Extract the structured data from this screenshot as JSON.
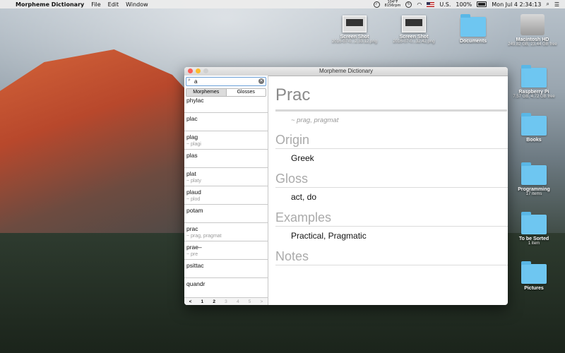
{
  "menubar": {
    "app_name": "Morpheme Dictionary",
    "menus": [
      "File",
      "Edit",
      "Window"
    ],
    "temperature": "104°F",
    "fan": "8156rpm",
    "input_source": "U.S.",
    "battery": "100%",
    "clock": "Mon Jul 4  2:34:13"
  },
  "desktop_icons": [
    {
      "name": "Screen Shot",
      "sub": "2016-07-0...2.33.12.png",
      "kind": "screenshot"
    },
    {
      "name": "Screen Shot",
      "sub": "2016-07-0...32.42.png",
      "kind": "screenshot"
    },
    {
      "name": "Documents",
      "sub": "",
      "kind": "folder"
    },
    {
      "name": "Macintosh HD",
      "sub": "249.82 GB, 23.44 GB free",
      "kind": "drive"
    },
    {
      "name": "Raspberry Pi",
      "sub": "7.57 GB, 4.72 GB free",
      "kind": "folder"
    },
    {
      "name": "Books",
      "sub": "",
      "kind": "folder"
    },
    {
      "name": "Programming",
      "sub": "17 items",
      "kind": "folder"
    },
    {
      "name": "To be Sorted",
      "sub": "1 item",
      "kind": "folder"
    },
    {
      "name": "Pictures",
      "sub": "",
      "kind": "folder"
    }
  ],
  "window": {
    "title": "Morpheme Dictionary",
    "search": {
      "value": "a",
      "placeholder": ""
    },
    "segments": {
      "morphemes": "Morphemes",
      "glosses": "Glosses"
    },
    "list": [
      {
        "main": "phylac",
        "variants": ""
      },
      {
        "main": "plac",
        "variants": ""
      },
      {
        "main": "plag",
        "variants": "~ plagi"
      },
      {
        "main": "plas",
        "variants": ""
      },
      {
        "main": "plat",
        "variants": "~ platy"
      },
      {
        "main": "plaud",
        "variants": "~ plod"
      },
      {
        "main": "potam",
        "variants": ""
      },
      {
        "main": "prac",
        "variants": "~ prag, pragmat"
      },
      {
        "main": "prae–",
        "variants": "~ pre"
      },
      {
        "main": "psittac",
        "variants": ""
      },
      {
        "main": "quandr",
        "variants": ""
      }
    ],
    "pager": {
      "prev": "<",
      "pages": [
        "1",
        "2",
        "3",
        "4",
        "5"
      ],
      "current": "2",
      "next": ">"
    },
    "detail": {
      "headword": "Prac",
      "variants": "~ prag, pragmat",
      "origin_title": "Origin",
      "origin": "Greek",
      "gloss_title": "Gloss",
      "gloss": "act, do",
      "examples_title": "Examples",
      "examples": "Practical, Pragmatic",
      "notes_title": "Notes"
    }
  }
}
